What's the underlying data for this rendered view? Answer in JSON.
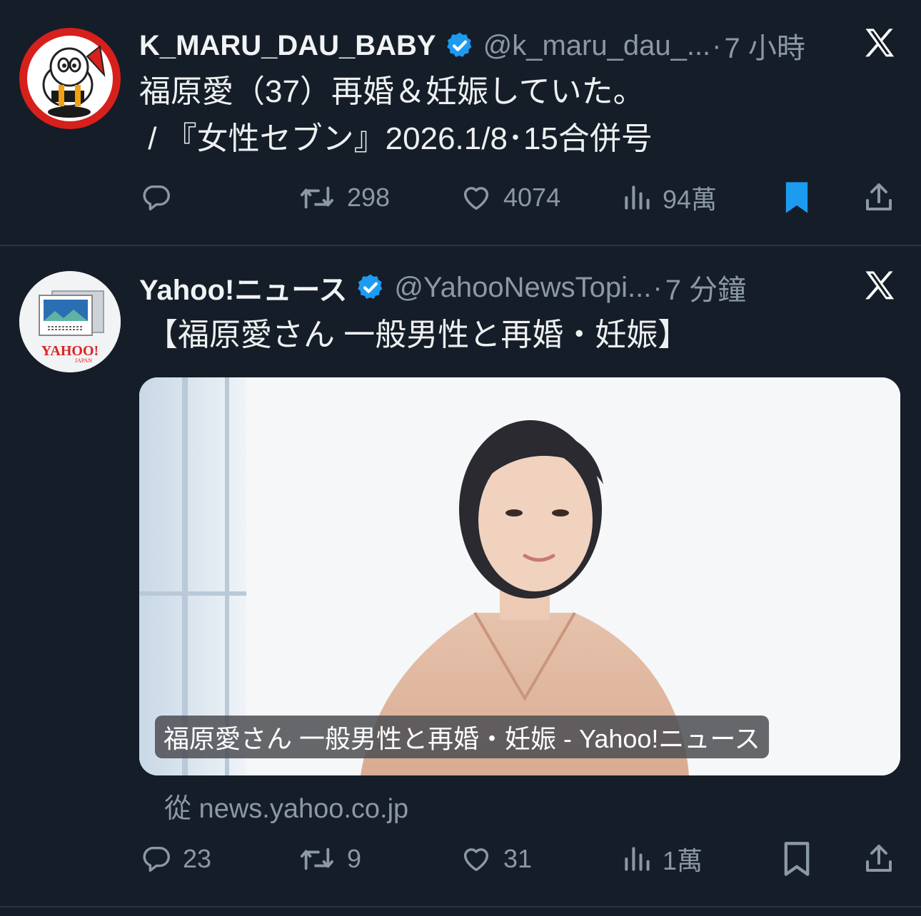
{
  "tweets": [
    {
      "author_name": "K_MARU_DAU_BABY",
      "handle": "@k_maru_dau_...",
      "time": "7 小時",
      "text_line1": "福原愛（37）再婚＆妊娠していた。",
      "text_line2": " / 『女性セブン』2026.1/8･15合併号",
      "retweets": "298",
      "likes": "4074",
      "views": "94萬",
      "replies": "",
      "bookmarked": true
    },
    {
      "author_name": "Yahoo!ニュース",
      "handle": "@YahooNewsTopi...",
      "time": "7 分鐘",
      "text_line1": "【福原愛さん 一般男性と再婚・妊娠】",
      "media_caption": "福原愛さん 一般男性と再婚・妊娠 - Yahoo!ニュース",
      "source": "從 news.yahoo.co.jp",
      "replies": "23",
      "retweets": "9",
      "likes": "31",
      "views": "1萬",
      "bookmarked": false
    }
  ],
  "icons": [
    "verified-badge-icon",
    "x-logo-icon",
    "reply-icon",
    "retweet-icon",
    "like-icon",
    "views-icon",
    "bookmark-icon",
    "share-icon"
  ],
  "colors": {
    "background": "#151d28",
    "verified": "#1d9bf0",
    "bookmark_active": "#1d9bf0",
    "muted": "#8b98a5"
  },
  "avatar_logo_text": "YAHOO! JAPAN"
}
